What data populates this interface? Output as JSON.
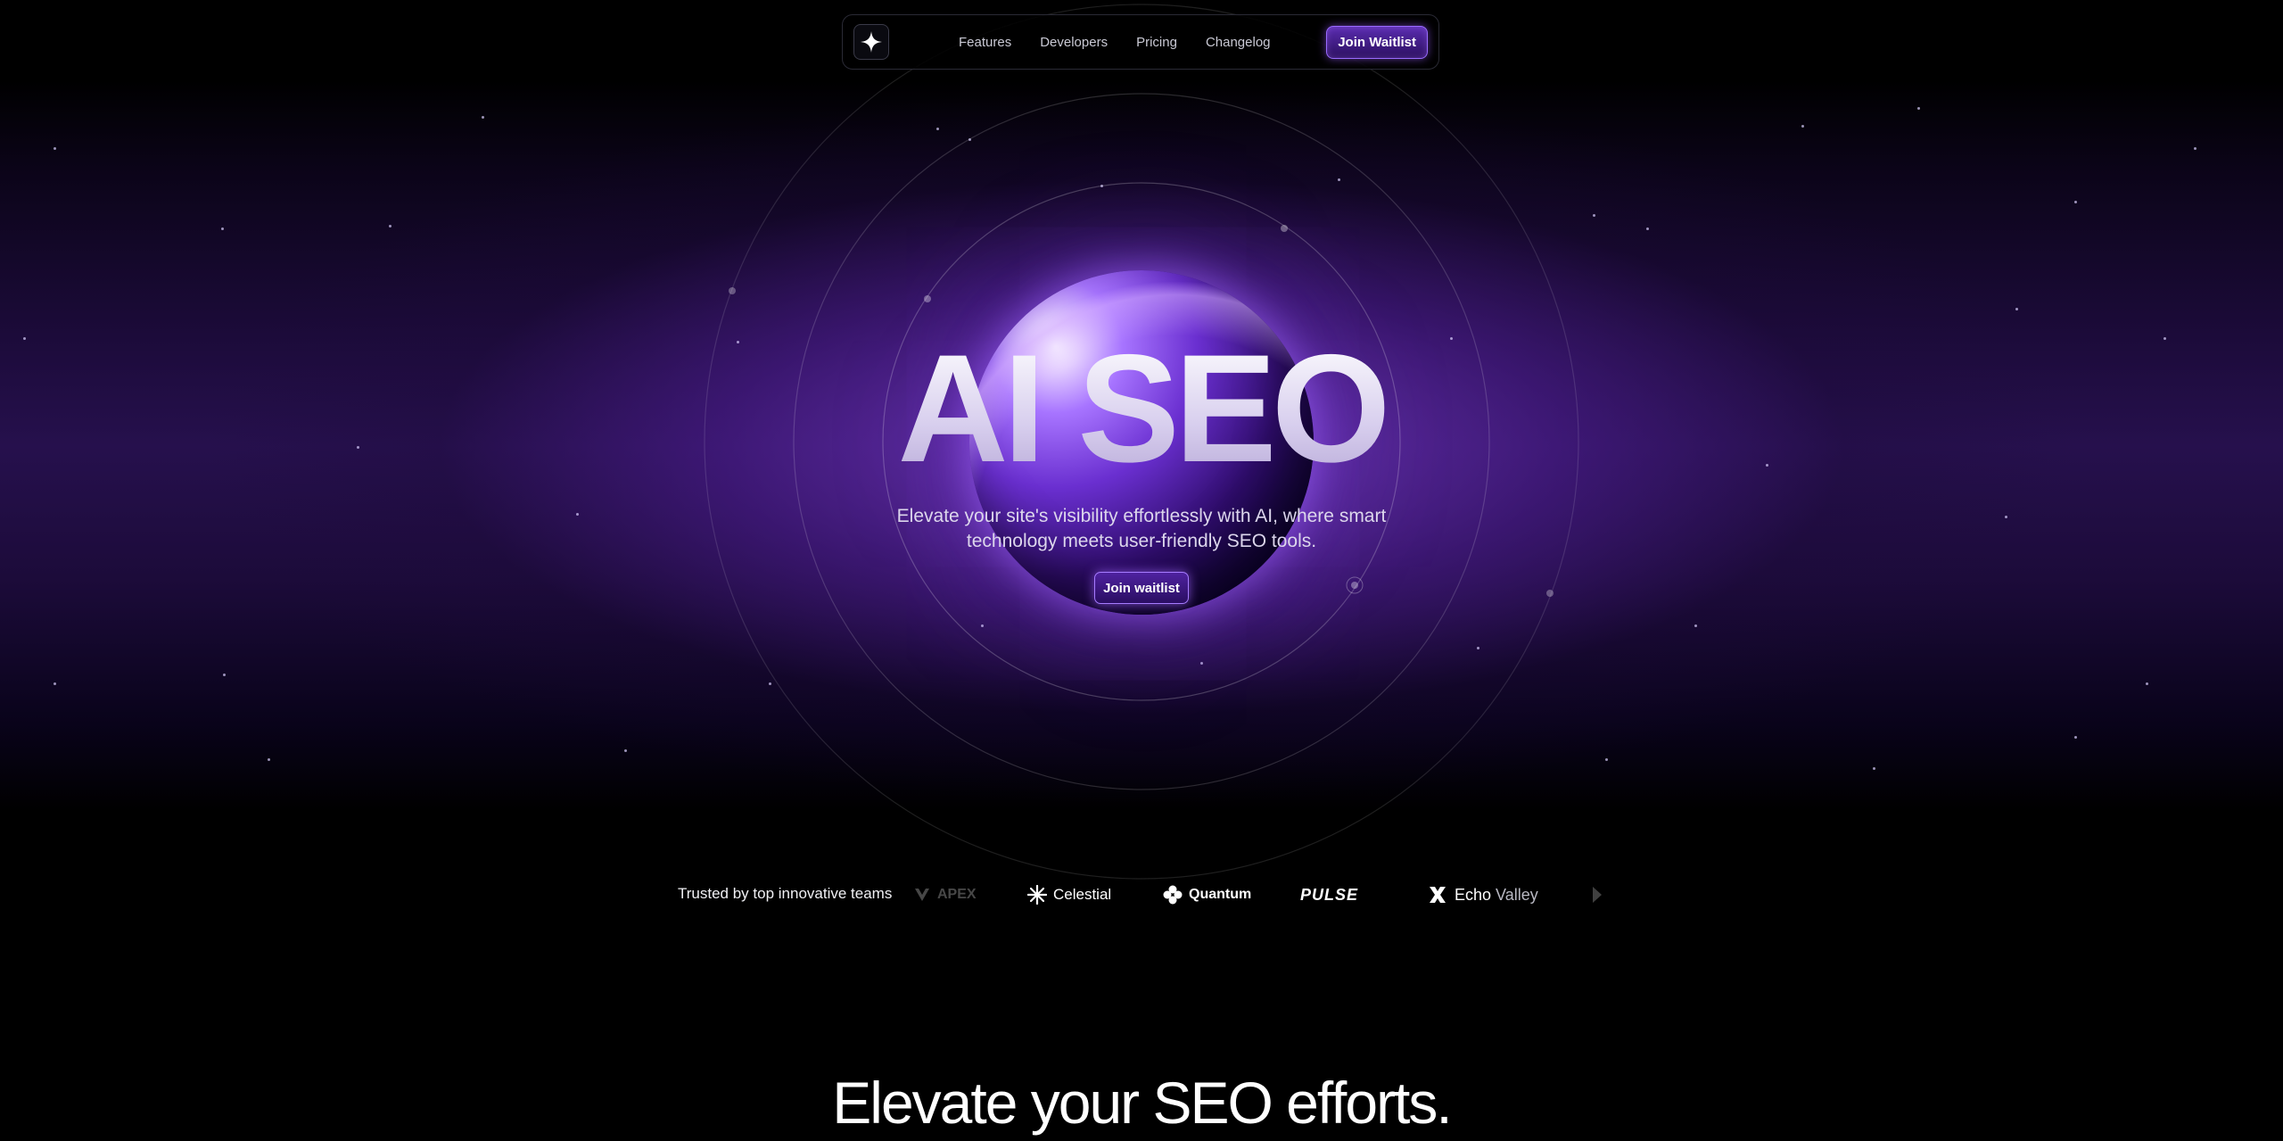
{
  "nav": {
    "logo_icon": "sparkle-icon",
    "links": [
      "Features",
      "Developers",
      "Pricing",
      "Changelog"
    ],
    "cta_label": "Join Waitlist"
  },
  "hero": {
    "title": "AI SEO",
    "subtitle": "Elevate your site's visibility effortlessly with AI, where smart technology meets user-friendly SEO tools.",
    "cta_label": "Join waitlist"
  },
  "trusted": {
    "label": "Trusted by top innovative teams",
    "logos": [
      {
        "name": "APEX",
        "icon": "apex-icon"
      },
      {
        "name": "Celestial",
        "icon": "asterisk-icon"
      },
      {
        "name": "Quantum",
        "icon": "clover-icon"
      },
      {
        "name": "PULSE",
        "icon": ""
      },
      {
        "name_part1": "Echo",
        "name_part2": "Valley",
        "icon": "x-icon"
      }
    ]
  },
  "section": {
    "title": "Elevate your SEO efforts."
  },
  "colors": {
    "accent": "#7b3fe4",
    "background": "#000000",
    "hero_glow": "#5a2cb0"
  }
}
